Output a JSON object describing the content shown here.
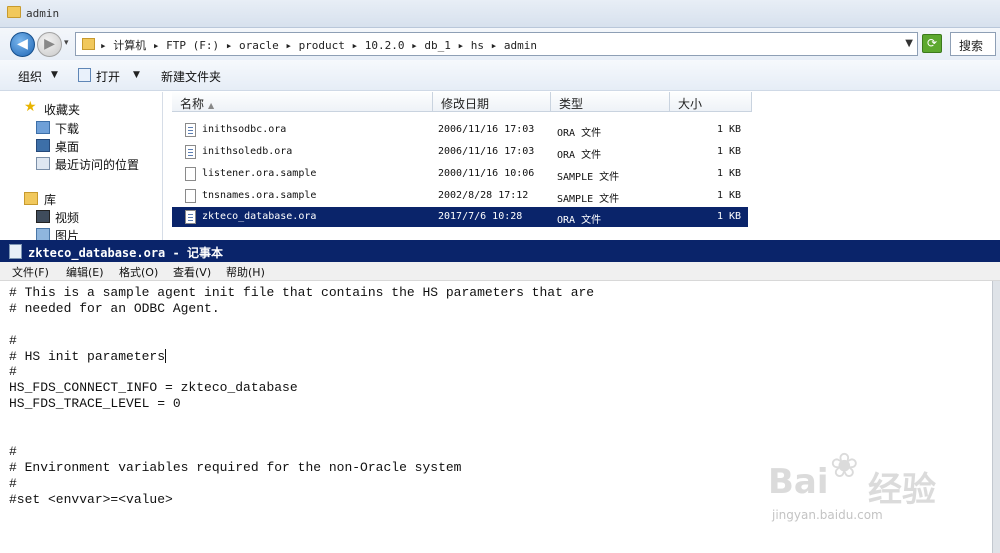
{
  "explorer": {
    "window_title": "admin",
    "breadcrumbs": "▸ 计算机 ▸ FTP (F:) ▸ oracle ▸ product ▸ 10.2.0 ▸ db_1 ▸ hs ▸ admin",
    "search_label": "搜索",
    "toolbar": {
      "organize": "组织",
      "open": "打开",
      "new_folder": "新建文件夹"
    },
    "nav": {
      "favorites": "收藏夹",
      "downloads": "下载",
      "desktop": "桌面",
      "recent": "最近访问的位置",
      "libraries": "库",
      "videos": "视频",
      "pictures": "图片"
    },
    "columns": {
      "name": "名称",
      "date": "修改日期",
      "type": "类型",
      "size": "大小"
    },
    "files": [
      {
        "name": "inithsodbc.ora",
        "date": "2006/11/16 17:03",
        "type": "ORA 文件",
        "size": "1 KB"
      },
      {
        "name": "inithsoledb.ora",
        "date": "2006/11/16 17:03",
        "type": "ORA 文件",
        "size": "1 KB"
      },
      {
        "name": "listener.ora.sample",
        "date": "2000/11/16 10:06",
        "type": "SAMPLE 文件",
        "size": "1 KB"
      },
      {
        "name": "tnsnames.ora.sample",
        "date": "2002/8/28 17:12",
        "type": "SAMPLE 文件",
        "size": "1 KB"
      },
      {
        "name": "zkteco_database.ora",
        "date": "2017/7/6 10:28",
        "type": "ORA 文件",
        "size": "1 KB"
      }
    ]
  },
  "notepad": {
    "title": "zkteco_database.ora - 记事本",
    "menu": {
      "file": "文件(F)",
      "edit": "编辑(E)",
      "format": "格式(O)",
      "view": "查看(V)",
      "help": "帮助(H)"
    },
    "lines": [
      "# This is a sample agent init file that contains the HS parameters that are",
      "# needed for an ODBC Agent.",
      "",
      "#",
      "# HS init parameters",
      "#",
      "HS_FDS_CONNECT_INFO = zkteco_database",
      "HS_FDS_TRACE_LEVEL = 0",
      "",
      "",
      "#",
      "# Environment variables required for the non-Oracle system",
      "#",
      "#set <envvar>=<value>"
    ]
  },
  "watermark": {
    "brand": "Bai",
    "brand_suffix": "经验",
    "url": "jingyan.baidu.com"
  }
}
